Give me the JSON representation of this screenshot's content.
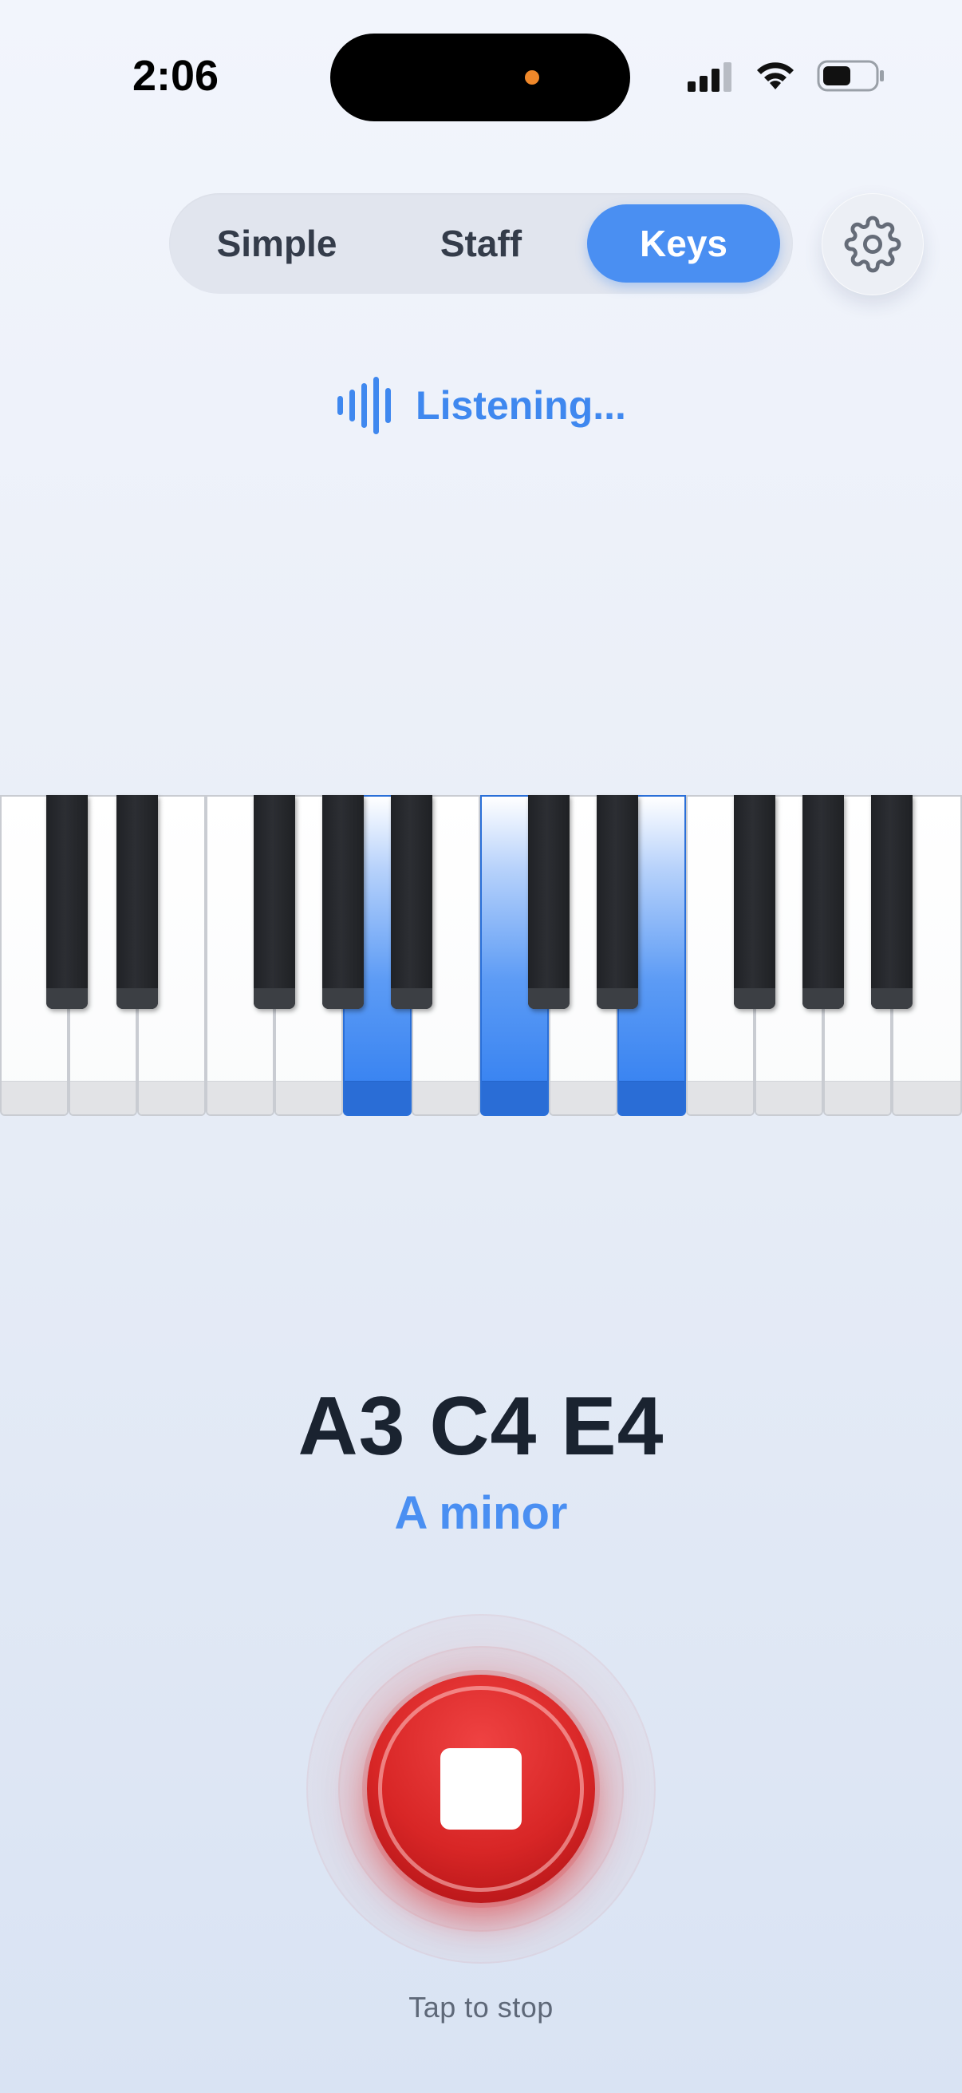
{
  "status_bar": {
    "time": "2:06",
    "icons": [
      "signal-icon",
      "wifi-icon",
      "battery-icon"
    ]
  },
  "mode_tabs": {
    "items": [
      {
        "label": "Simple",
        "selected": false
      },
      {
        "label": "Staff",
        "selected": false
      },
      {
        "label": "Keys",
        "selected": true
      }
    ]
  },
  "settings": {
    "icon": "gear-icon"
  },
  "listening": {
    "label": "Listening...",
    "icon": "sound-wave-icon"
  },
  "piano": {
    "active_keys": [
      "A3",
      "C4",
      "E4"
    ],
    "accent_color": "#2f7df0"
  },
  "detected": {
    "notes": "A3 C4 E4",
    "chord": "A minor"
  },
  "record": {
    "icon": "stop-icon",
    "hint": "Tap to stop",
    "color": "#d82626"
  }
}
